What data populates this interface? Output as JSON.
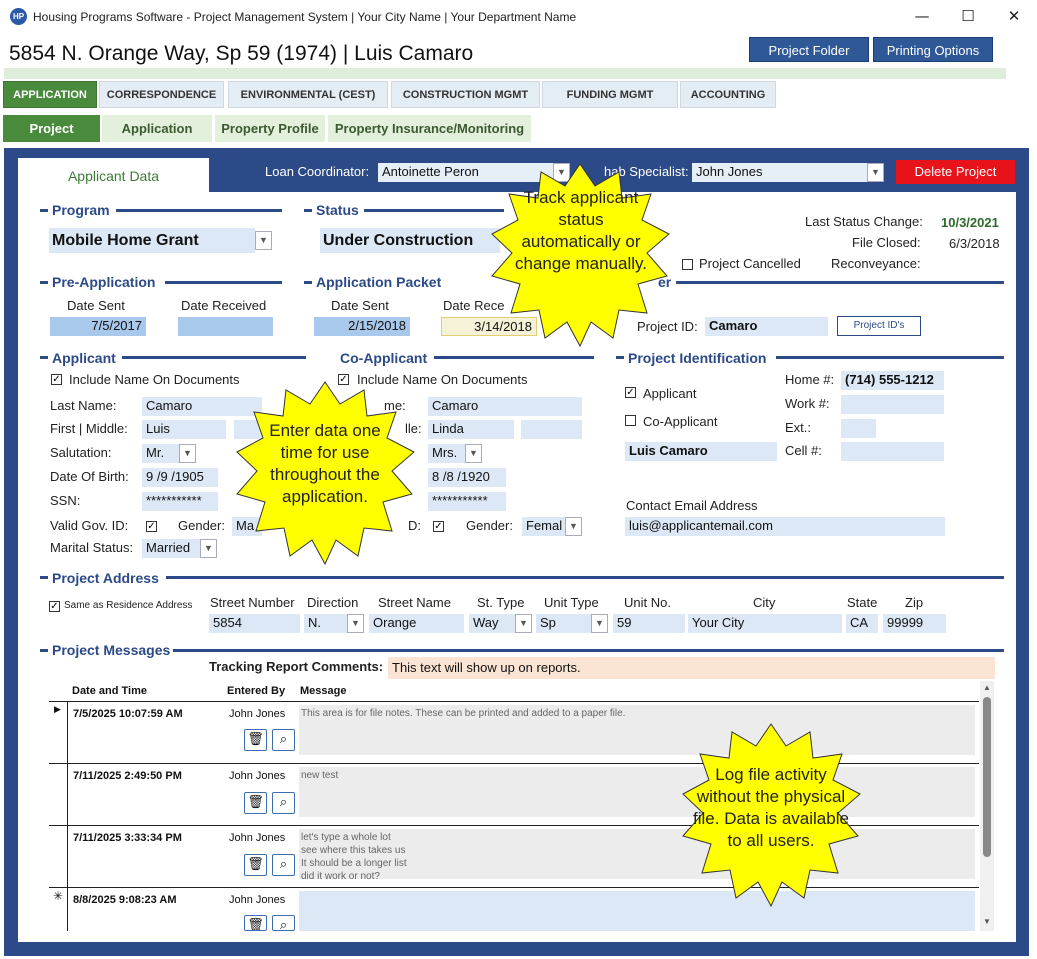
{
  "window": {
    "icon": "HP",
    "title": "Housing Programs Software - Project Management System | Your City Name | Your Department Name",
    "minimize": "—",
    "maximize": "☐",
    "close": "✕"
  },
  "header": {
    "title": "5854 N. Orange Way, Sp 59 (1974) | Luis Camaro",
    "project_folder": "Project Folder",
    "printing_options": "Printing Options"
  },
  "tabs": [
    "APPLICATION",
    "CORRESPONDENCE",
    "ENVIRONMENTAL (CEST)",
    "CONSTRUCTION MGMT",
    "FUNDING MGMT",
    "ACCOUNTING"
  ],
  "subtabs": [
    "Project",
    "Application",
    "Property Profile",
    "Property Insurance/Monitoring"
  ],
  "panel": {
    "tab_label": "Applicant Data",
    "loan_coordinator_label": "Loan Coordinator:",
    "loan_coordinator": "Antoinette Peron",
    "rehab_specialist_label": "hab Specialist:",
    "rehab_specialist": "John Jones",
    "delete": "Delete Project"
  },
  "program": {
    "title": "Program",
    "value": "Mobile Home Grant"
  },
  "status": {
    "title": "Status",
    "value": "Under Construction",
    "last_change_label": "Last Status Change:",
    "last_change": "10/3/2021",
    "file_closed_label": "File Closed:",
    "file_closed": "6/3/2018",
    "cancelled": "Project Cancelled",
    "reconveyance_label": "Reconveyance:"
  },
  "preapp": {
    "title": "Pre-Application",
    "sent_label": "Date Sent",
    "received_label": "Date Received",
    "sent": "7/5/2017",
    "received": ""
  },
  "packet": {
    "title": "Application Packet",
    "sent_label": "Date Sent",
    "received_label": "Date Rece",
    "sent": "2/15/2018",
    "received": "3/14/2018",
    "other_title": "er"
  },
  "project_id": {
    "label": "Project ID:",
    "value": "Camaro",
    "button": "Project ID's"
  },
  "applicant": {
    "title": "Applicant",
    "include": "Include Name On Documents",
    "last_label": "Last Name:",
    "last": "Camaro",
    "first_label": "First | Middle:",
    "first": "Luis",
    "salutation_label": "Salutation:",
    "salutation": "Mr.",
    "dob_label": "Date Of Birth:",
    "dob": "9 /9 /1905",
    "ssn_label": "SSN:",
    "ssn": "***********",
    "gov_label": "Valid Gov. ID:",
    "gender_label": "Gender:",
    "gender": "Ma",
    "marital_label": "Marital Status:",
    "marital": "Married"
  },
  "coapplicant": {
    "title": "Co-Applicant",
    "include": "Include Name On Documents",
    "last_label": "me:",
    "last": "Camaro",
    "first_label": "lle:",
    "first": "Linda",
    "salutation": "Mrs.",
    "dob": "8 /8 /1920",
    "ssn": "***********",
    "gov_label": "D:",
    "gender_label": "Gender:",
    "gender": "Femal"
  },
  "identification": {
    "title": "Project Identification",
    "applicant": "Applicant",
    "coapplicant": "Co-Applicant",
    "name": "Luis Camaro",
    "home_label": "Home #:",
    "home": "(714) 555-1212",
    "work_label": "Work #:",
    "ext_label": "Ext.:",
    "cell_label": "Cell #:",
    "email_label": "Contact Email Address",
    "email": "luis@applicantemail.com"
  },
  "address": {
    "title": "Project Address",
    "same": "Same as Residence Address",
    "labels": [
      "Street Number",
      "Direction",
      "Street Name",
      "St. Type",
      "Unit Type",
      "Unit No.",
      "City",
      "State",
      "Zip"
    ],
    "number": "5854",
    "direction": "N.",
    "street": "Orange",
    "st_type": "Way",
    "unit_type": "Sp",
    "unit_no": "59",
    "city": "Your City",
    "state": "CA",
    "zip": "99999"
  },
  "messages": {
    "title": "Project Messages",
    "tracking_label": "Tracking Report Comments:",
    "tracking": "This text will show up on reports.",
    "col_date": "Date and Time",
    "col_by": "Entered By",
    "col_msg": "Message",
    "rows": [
      {
        "date": "7/5/2025 10:07:59 AM",
        "by": "John Jones",
        "msg": "This area is for file notes. These can be printed and added to a paper file."
      },
      {
        "date": "7/11/2025 2:49:50 PM",
        "by": "John Jones",
        "msg": "new test"
      },
      {
        "date": "7/11/2025 3:33:34 PM",
        "by": "John Jones",
        "msg": "let's type a whole lot\nsee where this takes us\nIt should be a longer list\ndid it work or not?"
      },
      {
        "date": "8/8/2025 9:08:23 AM",
        "by": "John Jones",
        "msg": ""
      }
    ],
    "current_marker": "▶",
    "new_marker": "✳"
  },
  "callouts": {
    "status": "Track applicant status automatically or change manually.",
    "entry": "Enter data one time for use throughout the application.",
    "log": "Log  file activity without the physical file. Data is available to all users."
  },
  "colors": {
    "accent": "#2c4a87",
    "green": "#4a8a3c",
    "delete": "#e8121b",
    "callout": "#ffff00"
  }
}
